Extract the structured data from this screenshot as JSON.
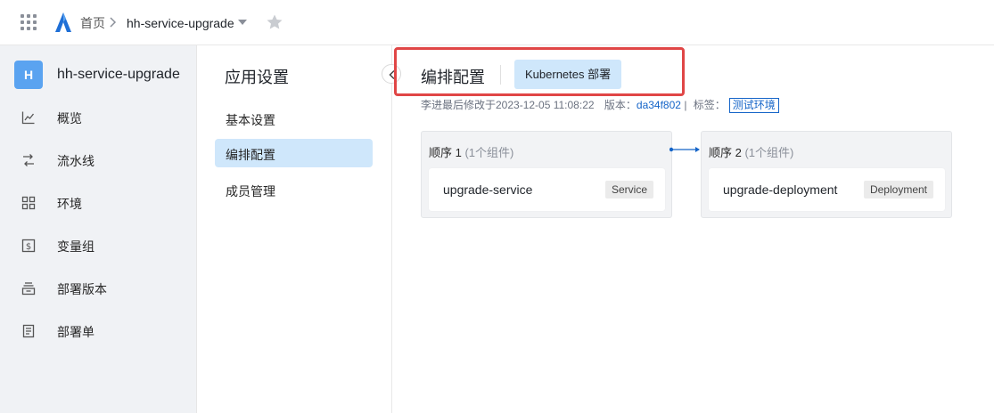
{
  "topbar": {
    "breadcrumb_home": "首页",
    "breadcrumb_app": "hh-service-upgrade"
  },
  "sidebar": {
    "avatar_letter": "H",
    "app_name": "hh-service-upgrade",
    "items": [
      {
        "label": "概览",
        "icon": "line-chart-icon"
      },
      {
        "label": "流水线",
        "icon": "pipeline-icon"
      },
      {
        "label": "环境",
        "icon": "grid-icon"
      },
      {
        "label": "变量组",
        "icon": "dollar-icon"
      },
      {
        "label": "部署版本",
        "icon": "inbox-icon"
      },
      {
        "label": "部署单",
        "icon": "document-icon"
      }
    ]
  },
  "settings": {
    "title": "应用设置",
    "items": [
      {
        "label": "基本设置",
        "active": false
      },
      {
        "label": "编排配置",
        "active": true
      },
      {
        "label": "成员管理",
        "active": false
      }
    ]
  },
  "main": {
    "title": "编排配置",
    "deploy_tag": "Kubernetes 部署",
    "meta": {
      "modified": "李进最后修改于2023-12-05 11:08:22",
      "version_label": "版本：",
      "version": "da34f802",
      "sep": "|",
      "tags_label": "标签：",
      "env_tag": "测试环境"
    },
    "stages": [
      {
        "order_label": "顺序 1",
        "count": "(1个组件)",
        "component": "upgrade-service",
        "type": "Service"
      },
      {
        "order_label": "顺序 2",
        "count": "(1个组件)",
        "component": "upgrade-deployment",
        "type": "Deployment"
      }
    ]
  },
  "colors": {
    "accent": "#1464c8",
    "active_bg": "#cfe7fb",
    "highlight_border": "#e04646",
    "avatar": "#5aa3f0"
  }
}
